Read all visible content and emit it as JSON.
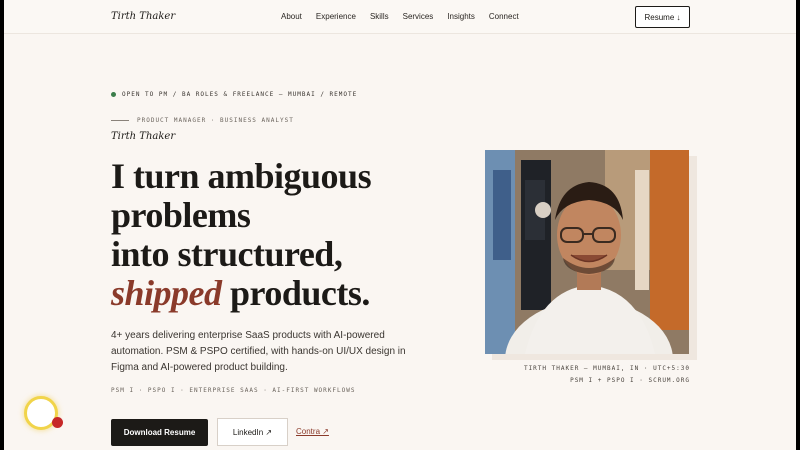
{
  "nav": {
    "brand": "Tirth Thaker",
    "links": [
      "About",
      "Experience",
      "Skills",
      "Services",
      "Insights",
      "Connect"
    ],
    "resume_label": "Resume ↓"
  },
  "hero": {
    "status": "Open to PM / BA roles & freelance — Mumbai / Remote",
    "role": "Product Manager · Business Analyst",
    "signature": "Tirth Thaker",
    "headline": {
      "line1": "I turn ambiguous",
      "line2": "problems",
      "line3": "into structured,",
      "accent": "shipped",
      "line4_rest": " products."
    },
    "description": "4+ years delivering enterprise SaaS products with AI-powered automation. PSM & PSPO certified, with hands-on UI/UX design in Figma and AI-powered product building.",
    "certs": "PSM I · PSPO I · Enterprise SaaS · AI-First Workflows",
    "buttons": {
      "download": "Download Resume",
      "linkedin": "LinkedIn ↗",
      "contra": "Contra ↗"
    }
  },
  "photo": {
    "caption_line1": "Tirth Thaker — Mumbai, IN · UTC+5:30",
    "caption_line2": "PSM I + PSPO I · Scrum.org"
  },
  "colors": {
    "background": "#faf6f2",
    "accent": "#8a3a2a",
    "text": "#1c1a17",
    "status_dot": "#3a7d4a"
  }
}
